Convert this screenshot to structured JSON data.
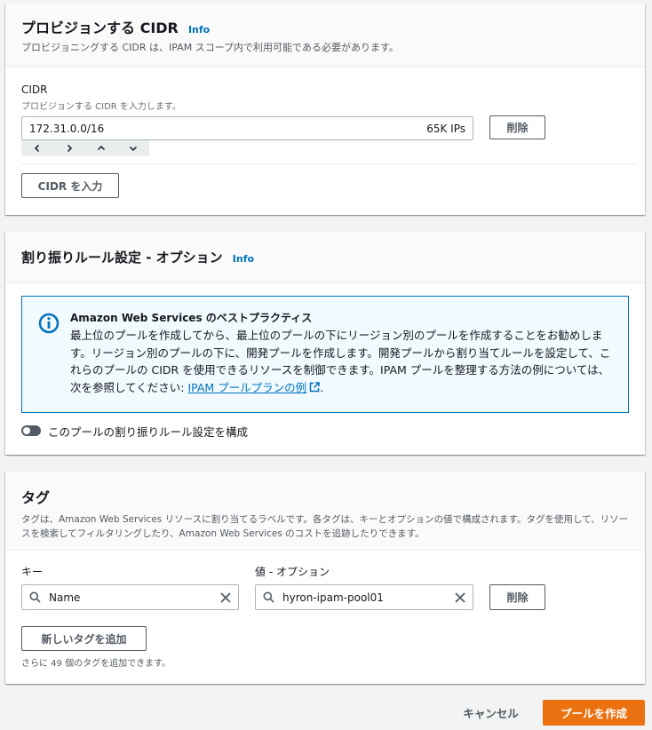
{
  "provision": {
    "title": "プロビジョンする CIDR",
    "info": "Info",
    "description": "プロビジョニングする CIDR は、IPAM スコープ内で利用可能である必要があります。",
    "cidr_label": "CIDR",
    "cidr_sublabel": "プロビジョンする CIDR を入力します。",
    "cidr_value": "172.31.0.0/16",
    "cidr_count": "65K IPs",
    "remove_label": "削除",
    "enter_cidr_label": "CIDR を入力"
  },
  "allocation": {
    "title": "割り振りルール設定 - オプション",
    "info": "Info",
    "alert_title": "Amazon Web Services のベストプラクティス",
    "alert_body": "最上位のプールを作成してから、最上位のプールの下にリージョン別のプールを作成することをお勧めします。リージョン別のプールの下に、開発プールを作成します。開発プールから割り当てルールを設定して、これらのプールの CIDR を使用できるリソースを制御できます。IPAM プールを整理する方法の例については、次を参照してください: ",
    "alert_link": "IPAM プールプランの例",
    "alert_end": ".",
    "toggle_label": "このプールの割り振りルール設定を構成",
    "toggle_on": false
  },
  "tags": {
    "title": "タグ",
    "description": "タグは、Amazon Web Services リソースに割り当てるラベルです。各タグは、キーとオプションの値で構成されます。タグを使用して、リソースを検索してフィルタリングしたり、Amazon Web Services のコストを追跡したりできます。",
    "key_label": "キー",
    "value_label": "値 - オプション",
    "key_value": "Name",
    "value_value": "hyron-ipam-pool01",
    "remove_label": "削除",
    "add_label": "新しいタグを追加",
    "remaining": "さらに 49 個のタグを追加できます。"
  },
  "footer": {
    "cancel_label": "キャンセル",
    "create_label": "プールを作成"
  },
  "colors": {
    "primary": "#ec7211",
    "link": "#0073bb",
    "alert_border": "#0073bb",
    "alert_bg": "#f1faff"
  }
}
